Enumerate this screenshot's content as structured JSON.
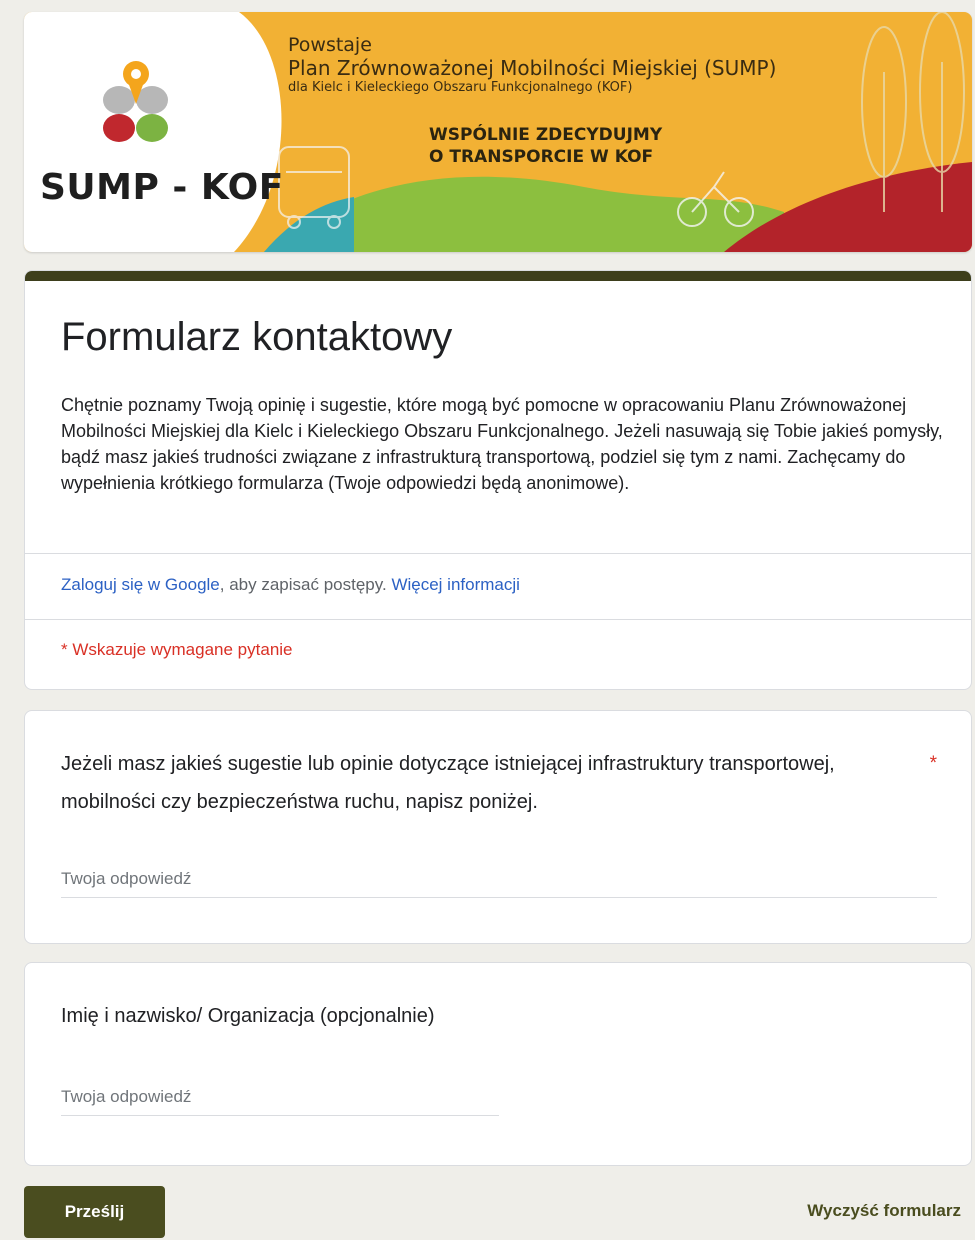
{
  "banner": {
    "logo_text": "SUMP - KOF",
    "line1": "Powstaje",
    "line2": "Plan Zrównoważonej Mobilności Miejskiej (SUMP)",
    "line3": "dla Kielc i Kieleckiego Obszaru Funkcjonalnego (KOF)",
    "slogan1": "WSPÓLNIE ZDECYDUJMY",
    "slogan2": "O TRANSPORCIE W KOF"
  },
  "form": {
    "title": "Formularz kontaktowy",
    "description": "Chętnie poznamy Twoją opinię i sugestie, które mogą być pomocne w opracowaniu Planu Zrównoważonej Mobilności Miejskiej dla Kielc i Kieleckiego Obszaru Funkcjonalnego. Jeżeli nasuwają się Tobie jakieś pomysły, bądź masz jakieś trudności związane z infrastrukturą transportową, podziel się tym z nami. Zachęcamy do wypełnienia krótkiego formularza (Twoje odpowiedzi będą anonimowe).",
    "signin_link": "Zaloguj się w Google",
    "signin_text": ", aby zapisać postępy.",
    "more_info_link": "Więcej informacji",
    "required_note": "* Wskazuje wymagane pytanie"
  },
  "questions": [
    {
      "text": "Jeżeli masz jakieś sugestie lub opinie dotyczące istniejącej infrastruktury transportowej, mobilności czy bezpieczeństwa ruchu, napisz poniżej.",
      "required_mark": "*",
      "placeholder": "Twoja odpowiedź"
    },
    {
      "text": "Imię i nazwisko/ Organizacja (opcjonalnie)",
      "placeholder": "Twoja odpowiedź"
    }
  ],
  "actions": {
    "submit_label": "Prześlij",
    "clear_label": "Wyczyść formularz"
  },
  "colors": {
    "accent": "#4a4d1f",
    "required": "#d93025",
    "link": "#2c61c4",
    "banner_yellow": "#f2b134",
    "banner_green": "#8cbf3f",
    "banner_red": "#b3232a"
  }
}
